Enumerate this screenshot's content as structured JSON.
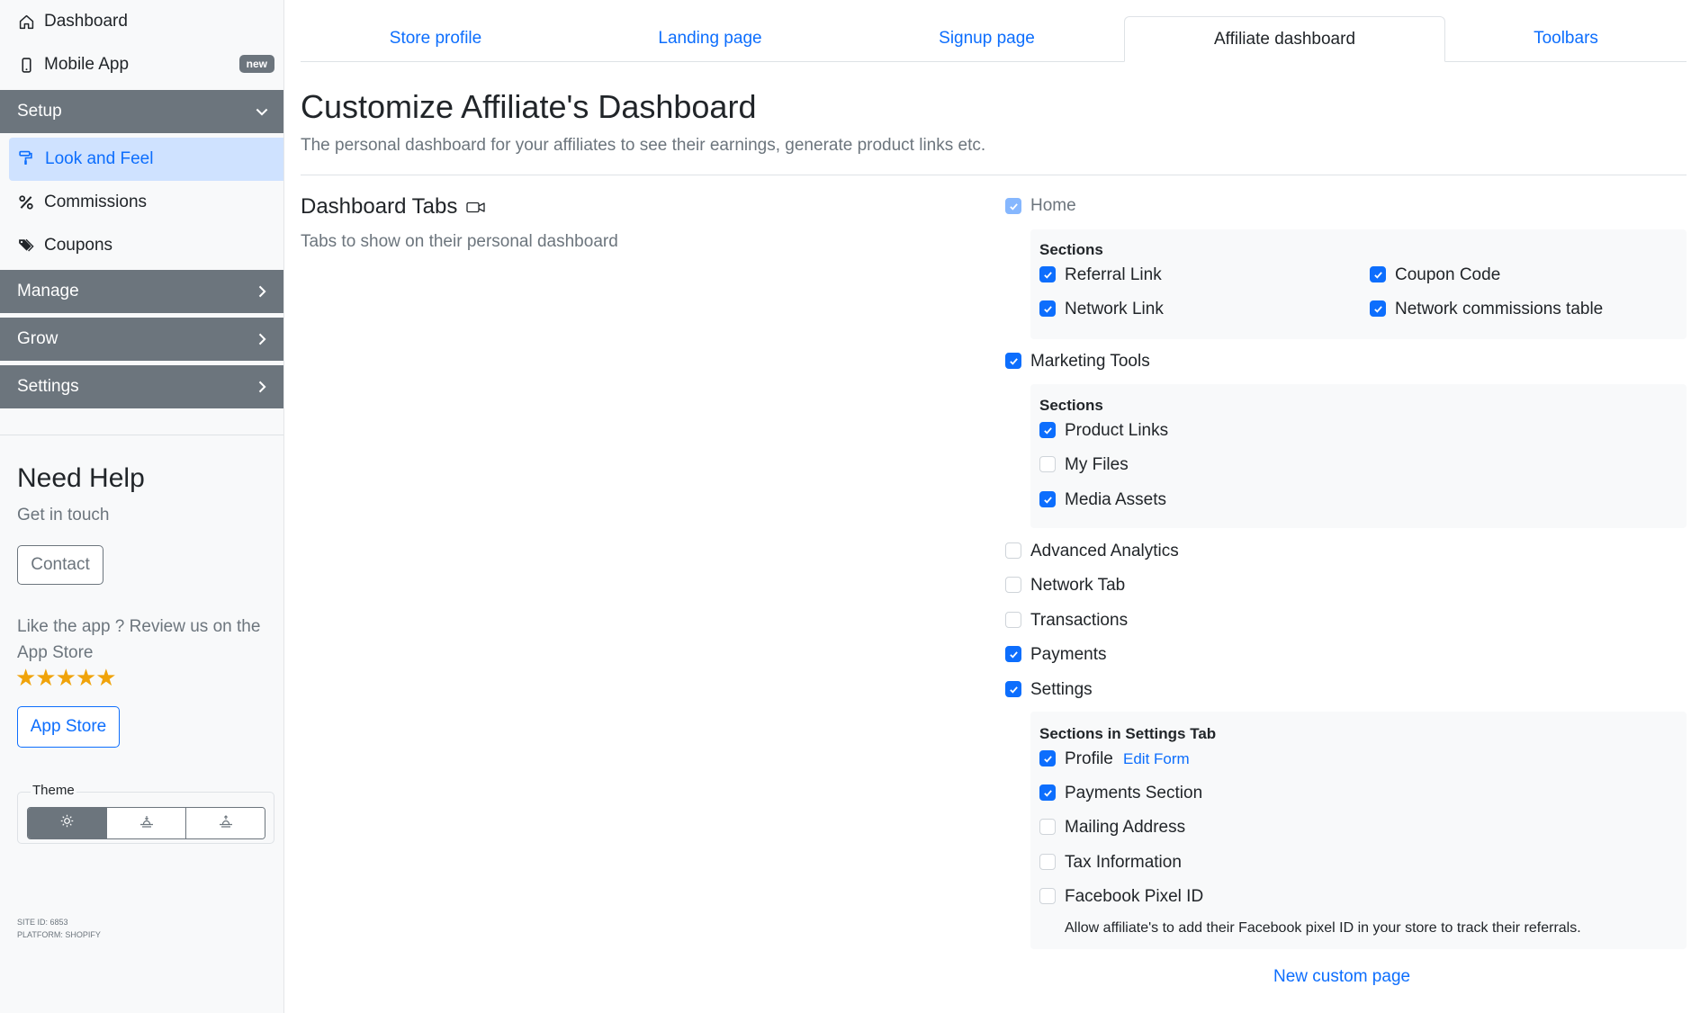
{
  "sidebar": {
    "dashboard": "Dashboard",
    "mobile_app": "Mobile App",
    "new_badge": "new",
    "setup": "Setup",
    "look_and_feel": "Look and Feel",
    "commissions": "Commissions",
    "coupons": "Coupons",
    "manage": "Manage",
    "grow": "Grow",
    "settings": "Settings"
  },
  "help": {
    "title": "Need Help",
    "subtitle": "Get in touch",
    "contact": "Contact",
    "review": "Like the app ? Review us on the App Store",
    "stars": "★★★★★",
    "rating": 5,
    "app_store": "App Store",
    "theme_label": "Theme",
    "site_id": "SITE ID: 6853",
    "platform": "PLATFORM: SHOPIFY"
  },
  "tabs": [
    "Store profile",
    "Landing page",
    "Signup page",
    "Affiliate dashboard",
    "Toolbars"
  ],
  "page": {
    "title": "Customize Affiliate's Dashboard",
    "subtitle": "The personal dashboard for your affiliates to see their earnings, generate product links etc."
  },
  "dashboard_tabs": {
    "title": "Dashboard Tabs",
    "subtitle": "Tabs to show on their personal dashboard",
    "home": {
      "label": "Home",
      "checked": true,
      "disabled": true
    },
    "home_sections_title": "Sections",
    "home_sections": [
      {
        "label": "Referral Link",
        "checked": true
      },
      {
        "label": "Coupon Code",
        "checked": true
      },
      {
        "label": "Network Link",
        "checked": true
      },
      {
        "label": "Network commissions table",
        "checked": true
      }
    ],
    "marketing": {
      "label": "Marketing Tools",
      "checked": true
    },
    "marketing_sections_title": "Sections",
    "marketing_sections": [
      {
        "label": "Product Links",
        "checked": true
      },
      {
        "label": "My Files",
        "checked": false
      },
      {
        "label": "Media Assets",
        "checked": true
      }
    ],
    "other_tabs": [
      {
        "label": "Advanced Analytics",
        "checked": false
      },
      {
        "label": "Network Tab",
        "checked": false
      },
      {
        "label": "Transactions",
        "checked": false
      },
      {
        "label": "Payments",
        "checked": true
      },
      {
        "label": "Settings",
        "checked": true
      }
    ],
    "settings_sections_title": "Sections in Settings Tab",
    "settings_sections": [
      {
        "label": "Profile",
        "checked": true
      },
      {
        "label": "Payments Section",
        "checked": true
      },
      {
        "label": "Mailing Address",
        "checked": false
      },
      {
        "label": "Tax Information",
        "checked": false
      },
      {
        "label": "Facebook Pixel ID",
        "checked": false
      }
    ],
    "edit_form": "Edit Form",
    "facebook_help": "Allow affiliate's to add their Facebook pixel ID in your store to track their referrals.",
    "new_custom_page": "New custom page"
  },
  "colors": {
    "accent": "#0d6efd",
    "sidebar_group": "#6c757d",
    "active_bg": "#cfe2ff",
    "star": "#f0a30a"
  }
}
